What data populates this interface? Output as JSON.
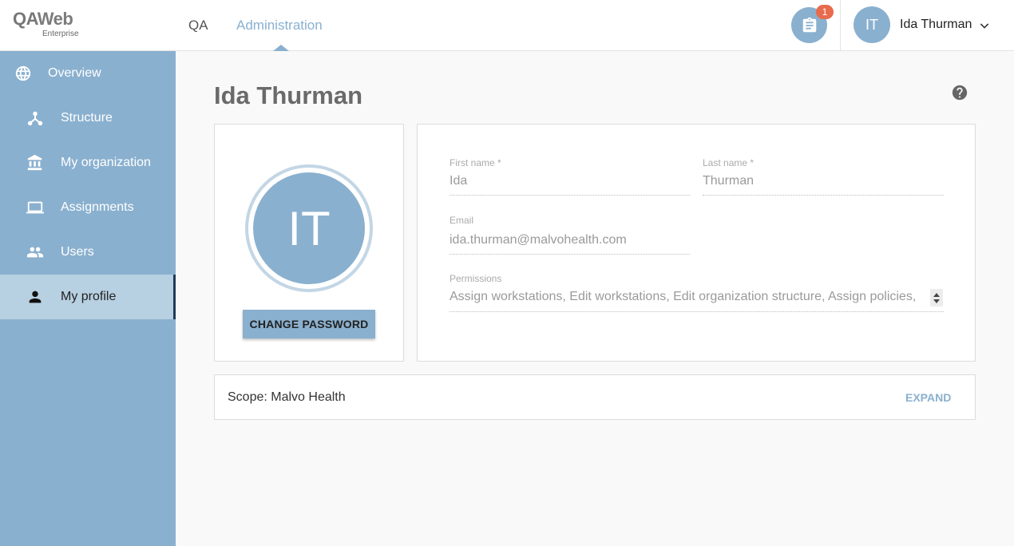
{
  "brand": {
    "name_a": "QA",
    "name_b": "Web",
    "edition": "Enterprise"
  },
  "topnav": [
    {
      "label": "QA",
      "active": false
    },
    {
      "label": "Administration",
      "active": true
    }
  ],
  "notifications": {
    "count": "1",
    "icon": "clipboard-icon"
  },
  "user": {
    "initials": "IT",
    "name": "Ida Thurman"
  },
  "sidebar": {
    "items": [
      {
        "label": "Overview",
        "icon": "globe-icon",
        "active": false
      },
      {
        "label": "Structure",
        "icon": "structure-icon",
        "active": false
      },
      {
        "label": "My organization",
        "icon": "bank-icon",
        "active": false
      },
      {
        "label": "Assignments",
        "icon": "laptop-icon",
        "active": false
      },
      {
        "label": "Users",
        "icon": "users-icon",
        "active": false
      },
      {
        "label": "My profile",
        "icon": "person-icon",
        "active": true
      }
    ]
  },
  "page": {
    "title": "Ida Thurman"
  },
  "profile": {
    "initials": "IT",
    "change_password_label": "CHANGE PASSWORD",
    "first_name_label": "First name *",
    "first_name": "Ida",
    "last_name_label": "Last name *",
    "last_name": "Thurman",
    "email_label": "Email",
    "email": "ida.thurman@malvohealth.com",
    "permissions_label": "Permissions",
    "permissions": "Assign workstations, Edit workstations, Edit organization structure, Assign policies,"
  },
  "scope": {
    "text": "Scope: Malvo Health",
    "expand_label": "EXPAND"
  },
  "colors": {
    "accent": "#8ab0cf",
    "badge": "#e86b4d",
    "active_bg": "#b7d0e2"
  }
}
